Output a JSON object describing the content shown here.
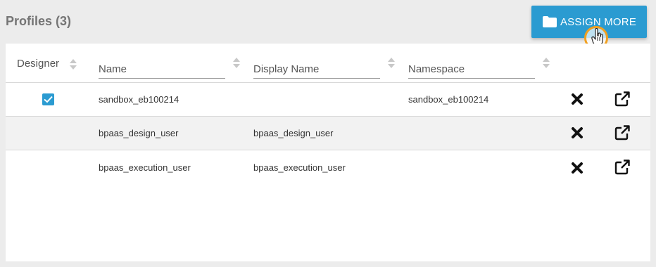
{
  "panel": {
    "title": "Profiles (3)"
  },
  "assign_button": {
    "label": "ASSIGN MORE",
    "icon": "folder-icon"
  },
  "colors": {
    "accent": "#2b9bd1",
    "cursor_ring": "#f0a020",
    "row_alt": "#f2f2f2"
  },
  "table": {
    "columns": {
      "designer": "Designer",
      "name": "Name",
      "display_name": "Display Name",
      "namespace": "Namespace"
    },
    "rows": [
      {
        "designer_checked": true,
        "name": "sandbox_eb100214",
        "display_name": "",
        "namespace": "sandbox_eb100214"
      },
      {
        "designer_checked": false,
        "name": "bpaas_design_user",
        "display_name": "bpaas_design_user",
        "namespace": ""
      },
      {
        "designer_checked": false,
        "name": "bpaas_execution_user",
        "display_name": "bpaas_execution_user",
        "namespace": ""
      }
    ],
    "row_actions": {
      "remove_icon": "close-icon",
      "open_icon": "external-link-icon"
    }
  }
}
